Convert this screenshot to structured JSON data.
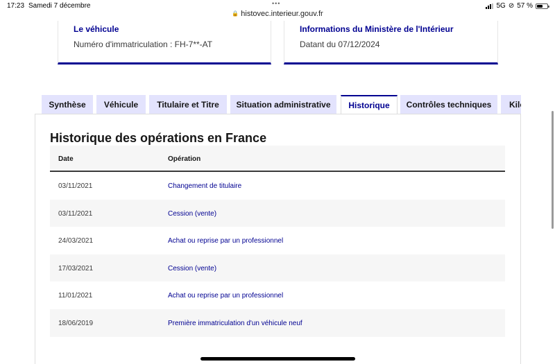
{
  "status_bar": {
    "time": "17:23",
    "date": "Samedi 7 décembre",
    "network": "5G",
    "battery": "57 %",
    "battery_level": 0.57
  },
  "browser": {
    "url": "histovec.interieur.gouv.fr",
    "lock_icon": "lock-icon"
  },
  "cards": {
    "vehicle": {
      "title": "Le véhicule",
      "value": "Numéro d'immatriculation : FH-7**-AT"
    },
    "ministry": {
      "title": "Informations du Ministère de l'Intérieur",
      "value": "Datant du 07/12/2024"
    }
  },
  "tabs": [
    {
      "label": "Synthèse"
    },
    {
      "label": "Véhicule"
    },
    {
      "label": "Titulaire et Titre"
    },
    {
      "label": "Situation administrative"
    },
    {
      "label": "Historique"
    },
    {
      "label": "Contrôles techniques"
    },
    {
      "label": "Kilo"
    }
  ],
  "active_tab": "Historique",
  "history": {
    "title": "Historique des opérations en France",
    "columns": {
      "date": "Date",
      "operation": "Opération"
    },
    "rows": [
      {
        "date": "03/11/2021",
        "operation": "Changement de titulaire"
      },
      {
        "date": "03/11/2021",
        "operation": "Cession (vente)"
      },
      {
        "date": "24/03/2021",
        "operation": "Achat ou reprise par un professionnel"
      },
      {
        "date": "17/03/2021",
        "operation": "Cession (vente)"
      },
      {
        "date": "11/01/2021",
        "operation": "Achat ou reprise par un professionnel"
      },
      {
        "date": "18/06/2019",
        "operation": "Première immatriculation d'un véhicule neuf"
      }
    ]
  },
  "colors": {
    "accent": "#000091",
    "tab_bg": "#e3e3fd",
    "row_alt": "#f6f6f6"
  }
}
